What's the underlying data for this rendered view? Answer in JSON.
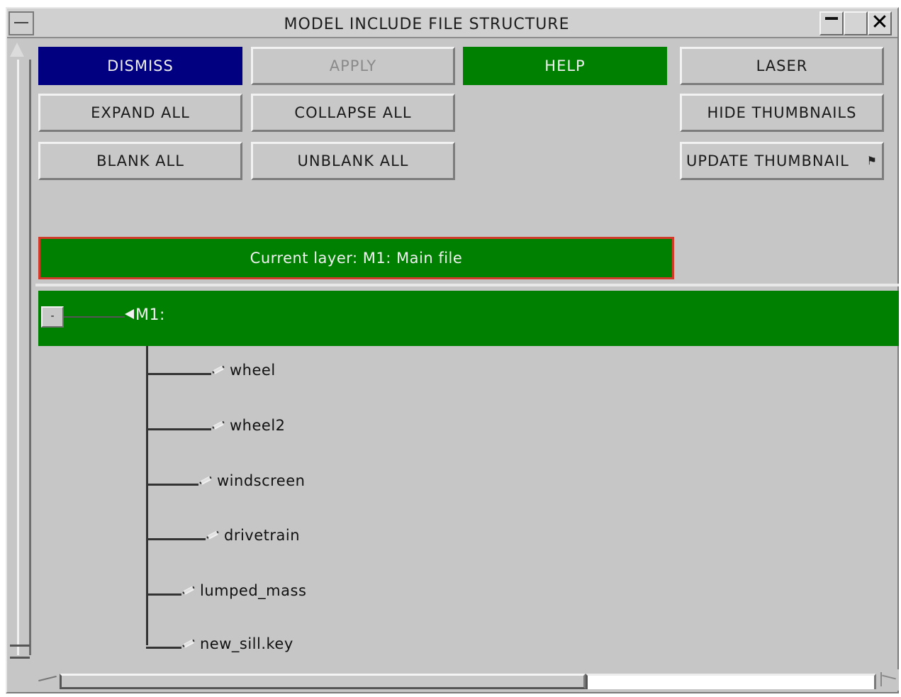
{
  "window": {
    "title": "MODEL INCLUDE FILE STRUCTURE",
    "close_glyph": "✕"
  },
  "buttons": {
    "dismiss": "DISMISS",
    "apply": "APPLY",
    "help": "HELP",
    "laser": "LASER",
    "expand_all": "EXPAND ALL",
    "collapse_all": "COLLAPSE ALL",
    "hide_thumbnails": "HIDE THUMBNAILS",
    "blank_all": "BLANK ALL",
    "unblank_all": "UNBLANK ALL",
    "update_thumbnail": "UPDATE THUMBNAIL"
  },
  "current_layer": "Current layer: M1: Main file",
  "tree": {
    "collapse_glyph": "-",
    "root_label": "M1:",
    "children": [
      {
        "label": "wheel"
      },
      {
        "label": "wheel2"
      },
      {
        "label": "windscreen"
      },
      {
        "label": "drivetrain"
      },
      {
        "label": "lumped_mass"
      },
      {
        "label": "new_sill.key"
      }
    ]
  },
  "colors": {
    "dismiss_bg": "#000080",
    "help_bg": "#008000",
    "current_layer_bg": "#008000",
    "current_layer_border": "#d23a2a",
    "root_row_bg": "#008000",
    "panel_bg": "#c6c6c6"
  }
}
